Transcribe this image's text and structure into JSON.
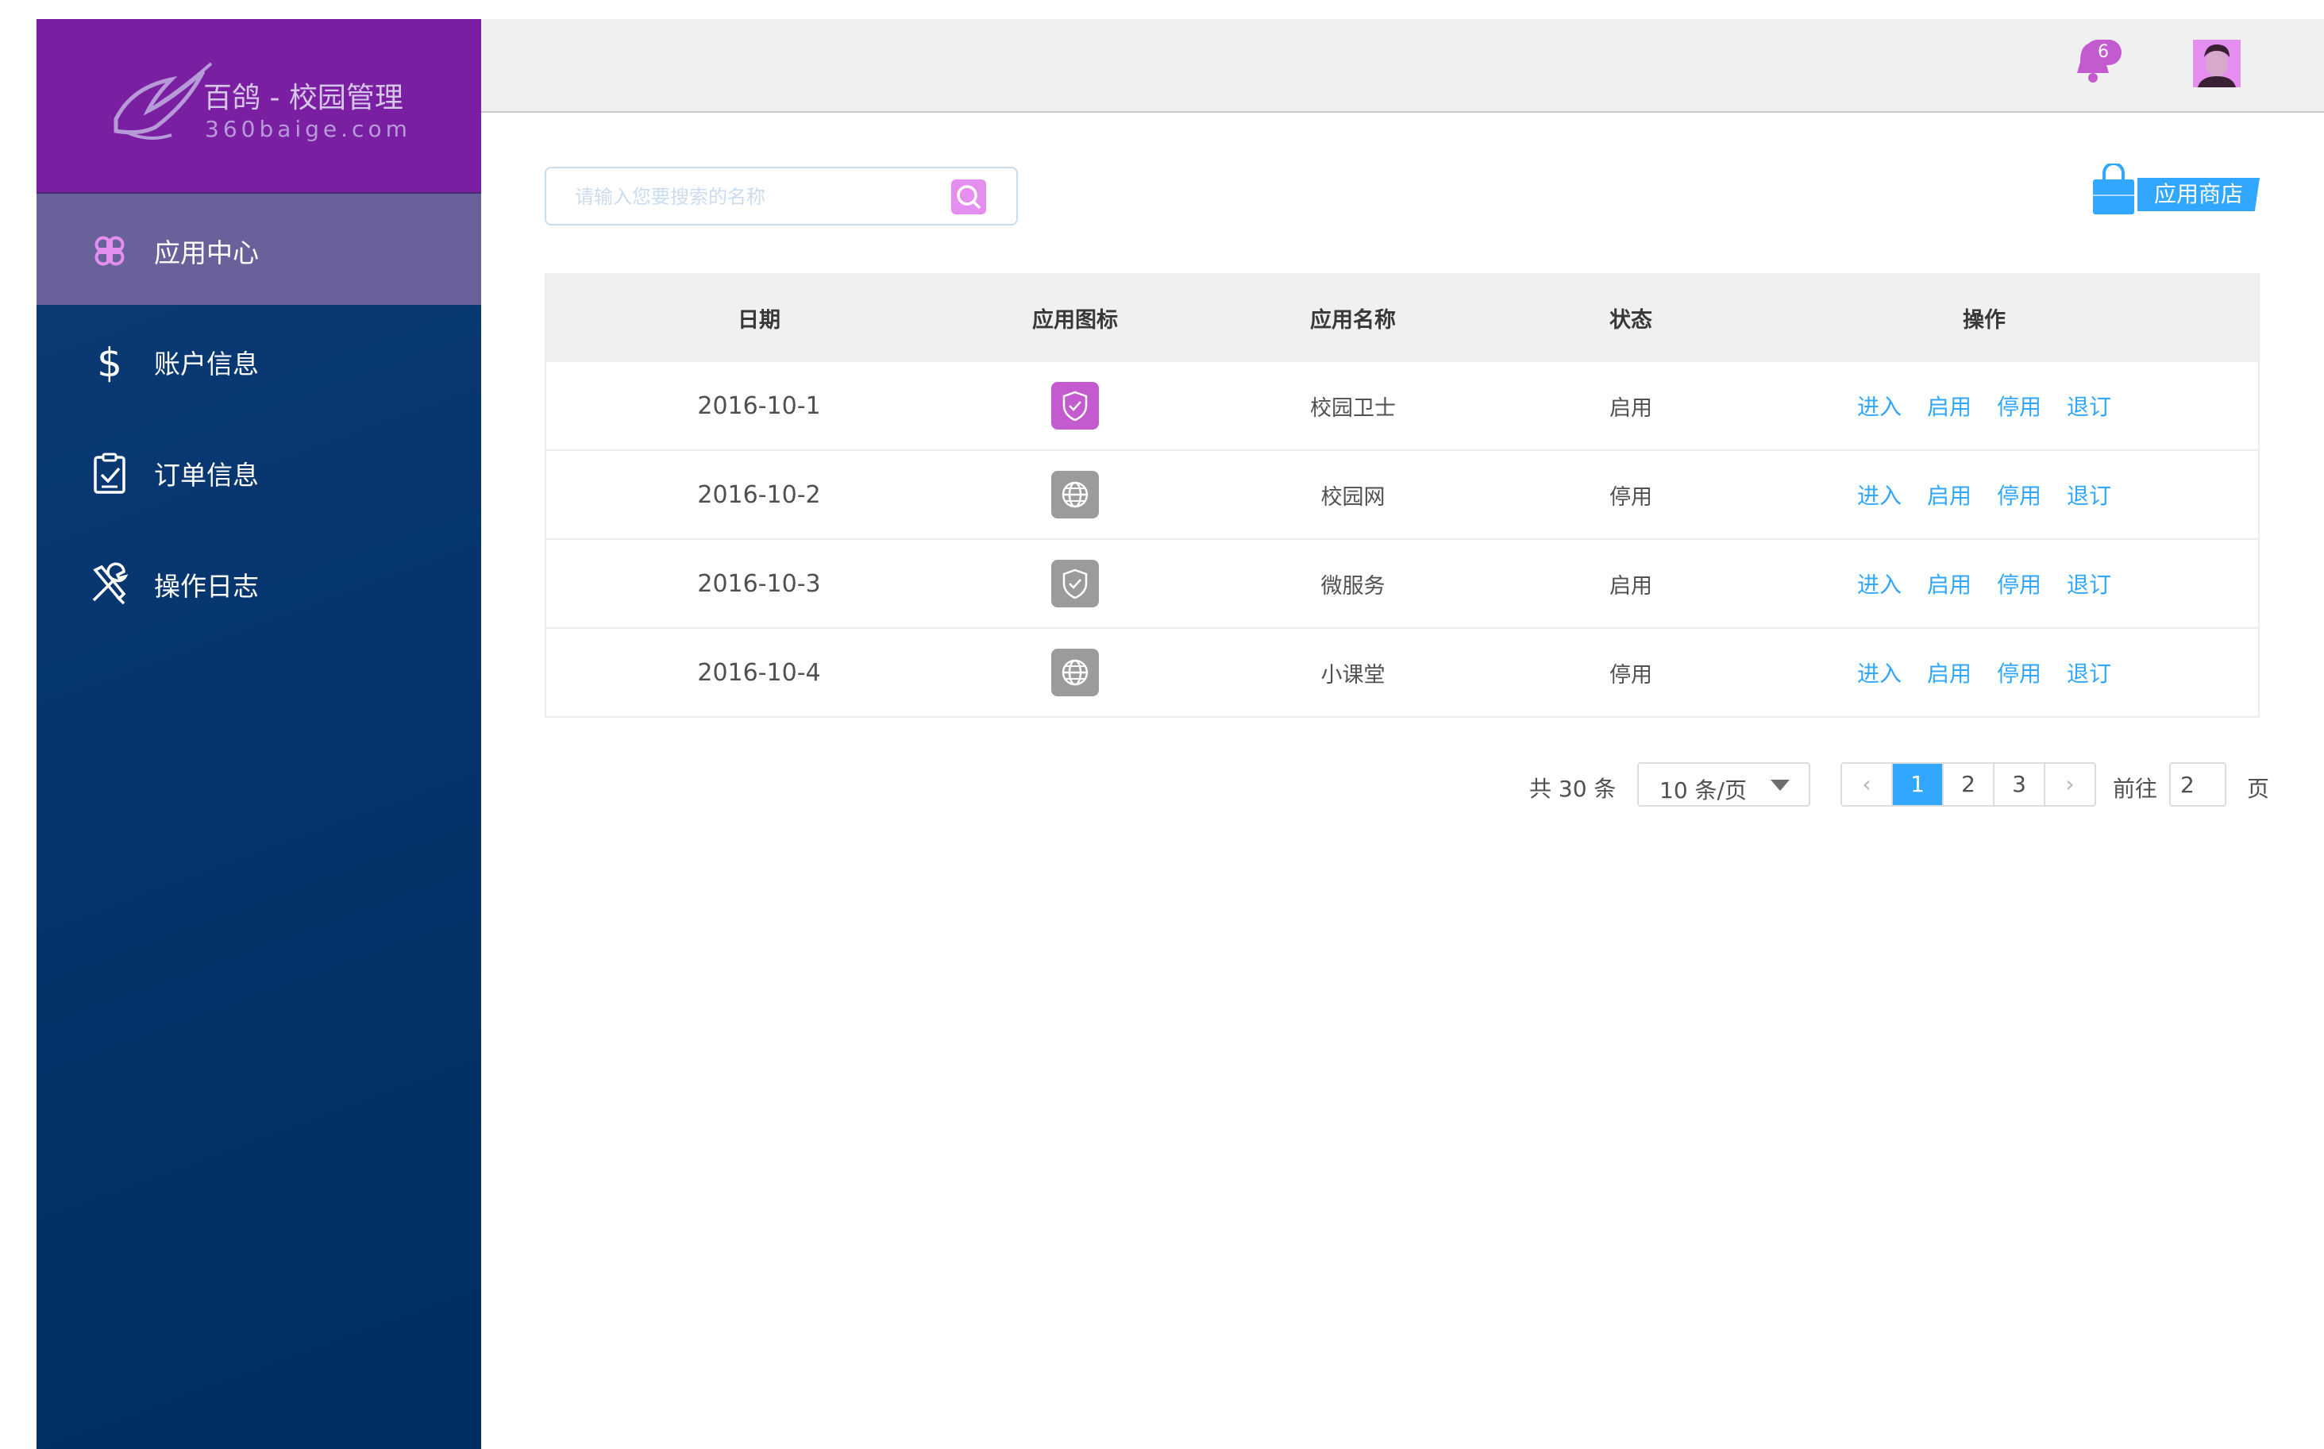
{
  "brand": {
    "title": "百鸽 - 校园管理",
    "domain": "360baige.com"
  },
  "sidebar": {
    "items": [
      {
        "label": "应用中心",
        "icon": "app-grid-icon",
        "active": true
      },
      {
        "label": "账户信息",
        "icon": "dollar-icon",
        "active": false
      },
      {
        "label": "订单信息",
        "icon": "clipboard-check-icon",
        "active": false
      },
      {
        "label": "操作日志",
        "icon": "tools-icon",
        "active": false
      }
    ]
  },
  "header": {
    "notification_count": "6",
    "icons": [
      "bell-icon",
      "avatar"
    ]
  },
  "search": {
    "placeholder": "请输入您要搜索的名称",
    "value": ""
  },
  "store_button": {
    "label": "应用商店"
  },
  "table": {
    "columns": [
      "日期",
      "应用图标",
      "应用名称",
      "状态",
      "操作"
    ],
    "rows": [
      {
        "date": "2016-10-1",
        "icon": "shield-check-icon",
        "icon_color": "#c35ad0",
        "name": "校园卫士",
        "status": "启用"
      },
      {
        "date": "2016-10-2",
        "icon": "globe-icon",
        "icon_color": "#9b9b9b",
        "name": "校园网",
        "status": "停用"
      },
      {
        "date": "2016-10-3",
        "icon": "shield-check-icon",
        "icon_color": "#9b9b9b",
        "name": "微服务",
        "status": "启用"
      },
      {
        "date": "2016-10-4",
        "icon": "globe-icon",
        "icon_color": "#9b9b9b",
        "name": "小课堂",
        "status": "停用"
      }
    ],
    "actions": [
      "进入",
      "启用",
      "停用",
      "退订"
    ]
  },
  "pagination": {
    "total": "共 30 条",
    "page_size": "10 条/页",
    "prev": "‹",
    "pages": [
      "1",
      "2",
      "3"
    ],
    "current": "1",
    "next": "›",
    "goto_label": "前往",
    "goto_value": "2",
    "page_suffix": "页"
  },
  "colors": {
    "brand": "#7b1fa2",
    "sidebar": "#06356e",
    "active_item": "#69629a",
    "accent": "#31a7ff",
    "text": "#505050",
    "topbar": "#f0f0f0",
    "border": "#cadced"
  }
}
